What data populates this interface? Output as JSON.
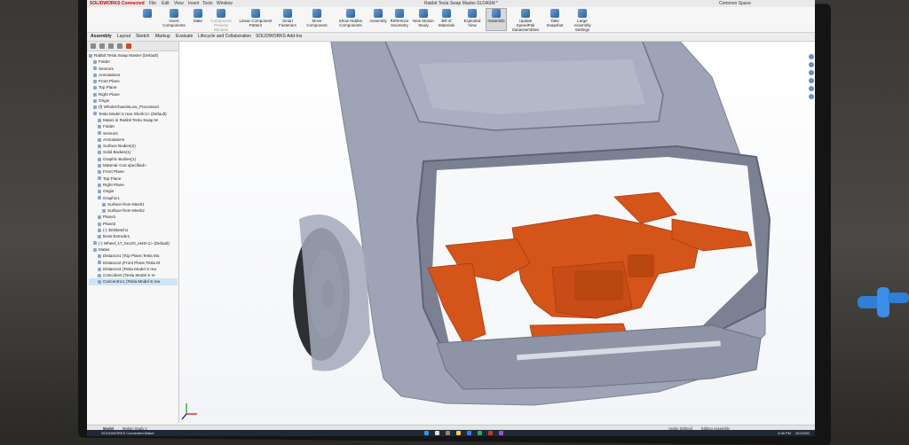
{
  "window": {
    "title": "Rabbit Tesla Swap Master.SLDASM *",
    "app": "SOLIDWORKS Connected",
    "menu": [
      "File",
      "Edit",
      "View",
      "Insert",
      "Tools",
      "Window"
    ],
    "user": "Common Space"
  },
  "ribbon": {
    "items": [
      {
        "label": "Insert Components"
      },
      {
        "label": "Mate"
      },
      {
        "label": "Component Preview Window"
      },
      {
        "label": "Linear Component Pattern"
      },
      {
        "label": "Smart Fasteners"
      },
      {
        "label": "Move Component"
      },
      {
        "label": "Show Hidden Components"
      },
      {
        "label": "Assembly"
      },
      {
        "label": "Reference Geometry"
      },
      {
        "label": "New Motion Study"
      },
      {
        "label": "Bill of Materials"
      },
      {
        "label": "Exploded View"
      },
      {
        "label": "Instant3D"
      },
      {
        "label": "Update SpeedPak Subassemblies"
      },
      {
        "label": "Take Snapshot"
      },
      {
        "label": "Large Assembly Settings"
      }
    ]
  },
  "tabs": [
    "Assembly",
    "Layout",
    "Sketch",
    "Markup",
    "Evaluate",
    "Lifecycle and Collaboration",
    "SOLIDWORKS Add-Ins"
  ],
  "tree": [
    {
      "label": "Rabbit Tesla Swap Master (Default)",
      "indent": 0
    },
    {
      "label": "Folder",
      "indent": 1
    },
    {
      "label": "Sensors",
      "indent": 1
    },
    {
      "label": "Annotations",
      "indent": 1
    },
    {
      "label": "Front Plane",
      "indent": 1
    },
    {
      "label": "Top Plane",
      "indent": 1
    },
    {
      "label": "Right Plane",
      "indent": 1
    },
    {
      "label": "Origin",
      "indent": 1
    },
    {
      "label": "(f) WholeChassisLow_Processed",
      "indent": 1
    },
    {
      "label": "Tesla Model S rear Shell<1> (Default)",
      "indent": 1
    },
    {
      "label": "Mates in Rabbit Tesla Swap M",
      "indent": 2
    },
    {
      "label": "Folder",
      "indent": 2
    },
    {
      "label": "Sensors",
      "indent": 2
    },
    {
      "label": "Annotations",
      "indent": 2
    },
    {
      "label": "Surface Bodies(2)",
      "indent": 2
    },
    {
      "label": "Solid Bodies(1)",
      "indent": 2
    },
    {
      "label": "Graphic Bodies(1)",
      "indent": 2
    },
    {
      "label": "Material <not specified>",
      "indent": 2
    },
    {
      "label": "Front Plane",
      "indent": 2
    },
    {
      "label": "Top Plane",
      "indent": 2
    },
    {
      "label": "Right Plane",
      "indent": 2
    },
    {
      "label": "Origin",
      "indent": 2
    },
    {
      "label": "Graphic1",
      "indent": 2
    },
    {
      "label": "Surface-from-Mesh1",
      "indent": 3
    },
    {
      "label": "Surface-from-Mesh2",
      "indent": 3
    },
    {
      "label": "Plane1",
      "indent": 2
    },
    {
      "label": "Plane2",
      "indent": 2
    },
    {
      "label": "(-) 3DSketch1",
      "indent": 2
    },
    {
      "label": "Boss-Extrude1",
      "indent": 2
    },
    {
      "label": "(-) Wheel_17_5x120_et40<1> (Default)",
      "indent": 1
    },
    {
      "label": "Mates",
      "indent": 1
    },
    {
      "label": "Distance1 (Top Plane,Tesla Mo",
      "indent": 2
    },
    {
      "label": "Distance2 (Front Plane,Tesla M",
      "indent": 2
    },
    {
      "label": "Distance3 (Tesla Model S rea",
      "indent": 2
    },
    {
      "label": "Coincident (Tesla Model S re",
      "indent": 2
    },
    {
      "label": "Concentric1 (Tesla Model S rea",
      "indent": 2
    }
  ],
  "tree_selected_index": 35,
  "status": {
    "left": "SOLIDWORKS Connected Maker",
    "under": "Under Defined",
    "mode": "Editing Assembly"
  },
  "bottom_tabs": [
    "Model",
    "Motion Study 1"
  ],
  "clock": {
    "time": "4:38 PM",
    "date": "02/13/2023"
  },
  "colors": {
    "motor": "#d4541a",
    "body": "#9aa0b3",
    "screen_bg": "#ffffff"
  }
}
